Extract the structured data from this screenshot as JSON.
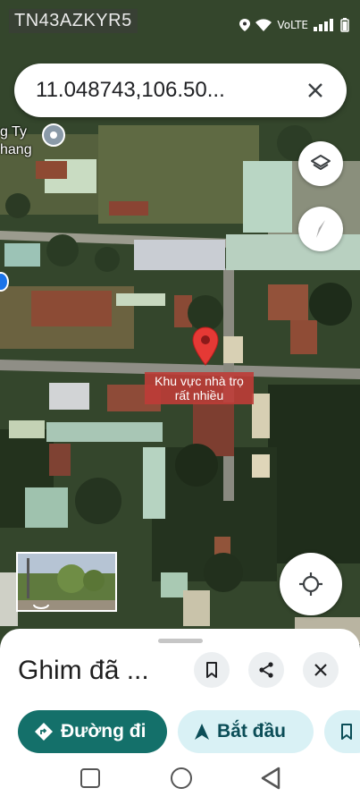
{
  "watermark": "TN43AZKYR5",
  "status": {
    "network": "VoLTE",
    "battery": "battery-icon",
    "wifi": "wifi-icon",
    "signal": "signal-icon",
    "location": "location-icon"
  },
  "search": {
    "value": "11.048743,106.50..."
  },
  "map": {
    "place_label_line1": "g Ty",
    "place_label_line2": "hang",
    "annotation_line1": "Khu vực nhà trọ",
    "annotation_line2": "rất nhiều",
    "pin_color": "#e53935"
  },
  "sheet": {
    "title": "Ghim đã ...",
    "directions_label": "Đường đi",
    "start_label": "Bắt đầu"
  },
  "colors": {
    "accent": "#14706a",
    "chip_secondary": "#d9f1f5",
    "annotation_bg": "#be3c37"
  }
}
